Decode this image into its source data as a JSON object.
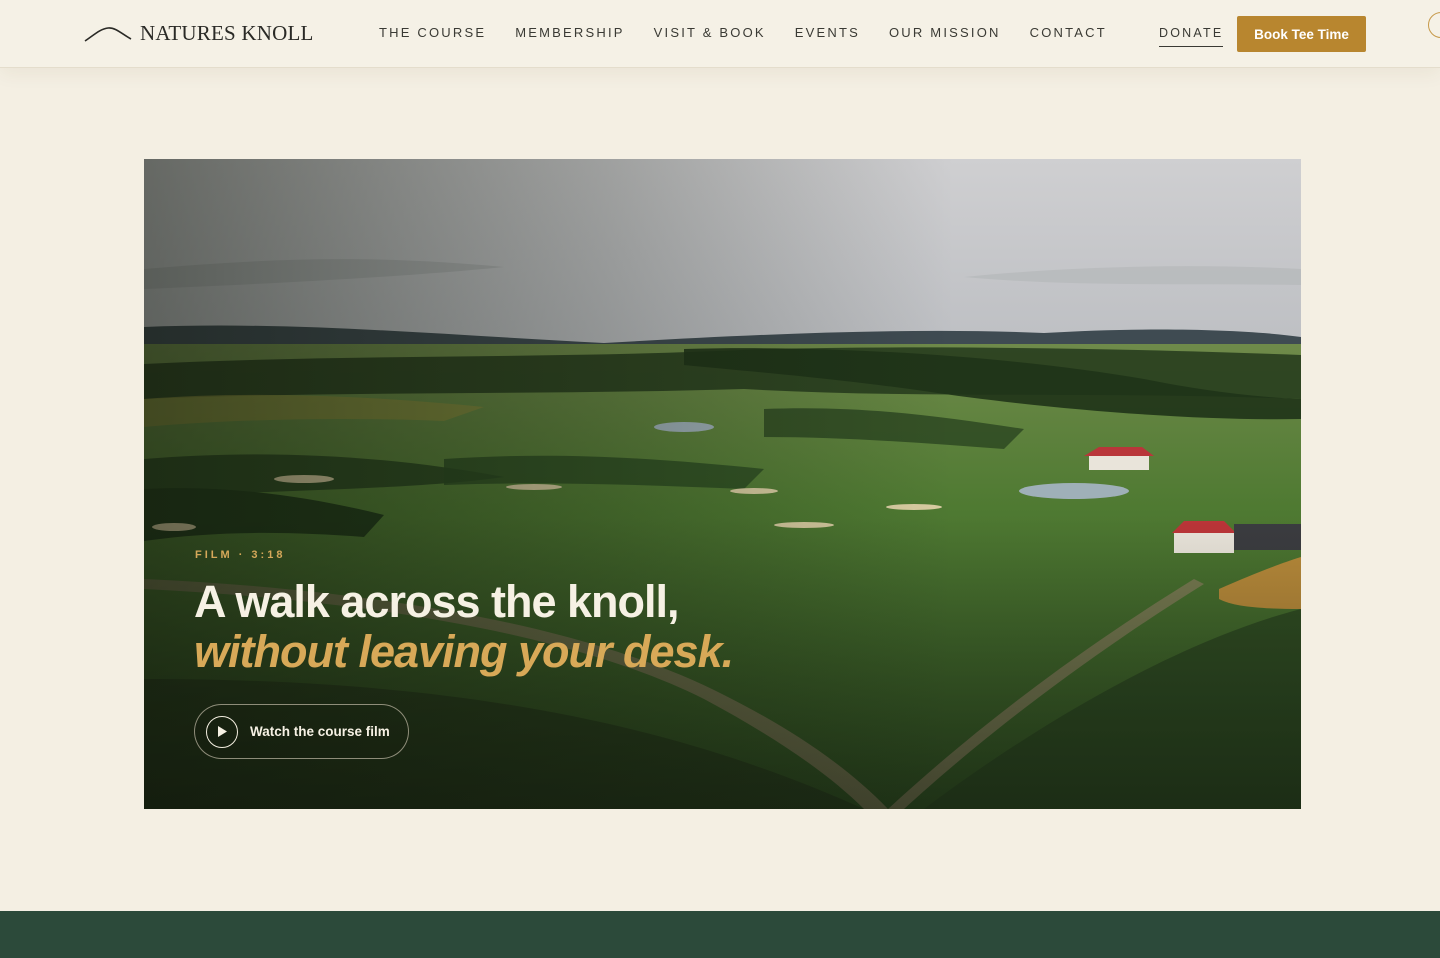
{
  "brand": {
    "name": "NATURES KNOLL",
    "logo_icon": "hill-curve-icon"
  },
  "nav": {
    "items": [
      {
        "label": "THE COURSE"
      },
      {
        "label": "MEMBERSHIP"
      },
      {
        "label": "VISIT & BOOK"
      },
      {
        "label": "EVENTS"
      },
      {
        "label": "OUR MISSION"
      },
      {
        "label": "CONTACT"
      }
    ],
    "donate_label": "DONATE",
    "cta_label": "Book Tee Time"
  },
  "hero": {
    "eyebrow": "FILM · 3:18",
    "headline": "A walk across the knoll,",
    "headline_accent": "without leaving your desk.",
    "button_label": "Watch the course film",
    "button_icon": "play-icon"
  },
  "colors": {
    "background": "#f4efe3",
    "accent_gold": "#b8862f",
    "headline_gold": "#d8a958",
    "forest_band": "#2c4a3a",
    "text_dark": "#2a2a26"
  }
}
